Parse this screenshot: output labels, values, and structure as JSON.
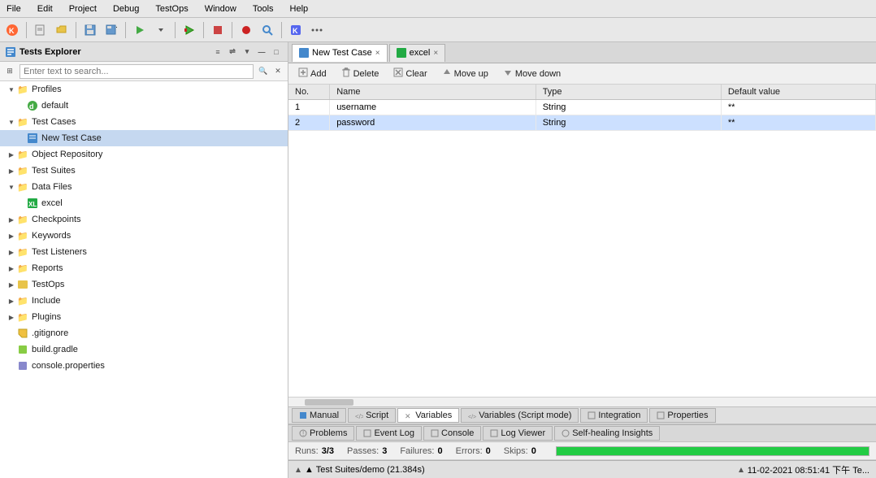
{
  "menu": {
    "items": [
      "File",
      "Edit",
      "Project",
      "Debug",
      "TestOps",
      "Window",
      "Tools",
      "Help"
    ]
  },
  "leftPanel": {
    "title": "Tests Explorer",
    "searchPlaceholder": "Enter text to search...",
    "tree": [
      {
        "id": "profiles",
        "label": "Profiles",
        "level": 0,
        "type": "folder",
        "expanded": true
      },
      {
        "id": "default",
        "label": "default",
        "level": 1,
        "type": "profile-file"
      },
      {
        "id": "testcases",
        "label": "Test Cases",
        "level": 0,
        "type": "folder",
        "expanded": true
      },
      {
        "id": "newtestcase",
        "label": "New Test Case",
        "level": 1,
        "type": "testcase",
        "selected": true
      },
      {
        "id": "objectrepo",
        "label": "Object Repository",
        "level": 0,
        "type": "folder",
        "expanded": false
      },
      {
        "id": "testsuites",
        "label": "Test Suites",
        "level": 0,
        "type": "folder",
        "expanded": false
      },
      {
        "id": "datafiles",
        "label": "Data Files",
        "level": 0,
        "type": "folder",
        "expanded": true
      },
      {
        "id": "excel",
        "label": "excel",
        "level": 1,
        "type": "data-file"
      },
      {
        "id": "checkpoints",
        "label": "Checkpoints",
        "level": 0,
        "type": "folder",
        "expanded": false
      },
      {
        "id": "keywords",
        "label": "Keywords",
        "level": 0,
        "type": "folder",
        "expanded": false
      },
      {
        "id": "testlisteners",
        "label": "Test Listeners",
        "level": 0,
        "type": "folder",
        "expanded": false
      },
      {
        "id": "reports",
        "label": "Reports",
        "level": 0,
        "type": "folder",
        "expanded": false
      },
      {
        "id": "testops",
        "label": "TestOps",
        "level": 0,
        "type": "folder",
        "expanded": false
      },
      {
        "id": "include",
        "label": "Include",
        "level": 0,
        "type": "folder",
        "expanded": false
      },
      {
        "id": "plugins",
        "label": "Plugins",
        "level": 0,
        "type": "folder",
        "expanded": false
      },
      {
        "id": "gitignore",
        "label": ".gitignore",
        "level": 0,
        "type": "file-git"
      },
      {
        "id": "buildgradle",
        "label": "build.gradle",
        "level": 0,
        "type": "file-gradle"
      },
      {
        "id": "consoleprops",
        "label": "console.properties",
        "level": 0,
        "type": "file-props"
      }
    ]
  },
  "tabs": [
    {
      "id": "newtestcase-tab",
      "label": "New Test Case",
      "active": true,
      "closable": true
    },
    {
      "id": "excel-tab",
      "label": "excel",
      "active": false,
      "closable": true
    }
  ],
  "contentToolbar": {
    "add": "Add",
    "delete": "Delete",
    "clear": "Clear",
    "moveup": "Move up",
    "movedown": "Move down"
  },
  "table": {
    "columns": [
      {
        "id": "no",
        "label": "No."
      },
      {
        "id": "name",
        "label": "Name"
      },
      {
        "id": "type",
        "label": "Type"
      },
      {
        "id": "default",
        "label": "Default value"
      }
    ],
    "rows": [
      {
        "no": "1",
        "name": "username",
        "type": "String",
        "default": "**",
        "selected": false
      },
      {
        "no": "2",
        "name": "password",
        "type": "String",
        "default": "**",
        "selected": true
      }
    ]
  },
  "bottomTabs": {
    "items": [
      "Manual",
      "Script",
      "Variables",
      "Variables (Script mode)",
      "Integration",
      "Properties"
    ]
  },
  "consoleTabs": {
    "items": [
      "Problems",
      "Event Log",
      "Console",
      "Log Viewer",
      "Self-healing Insights"
    ]
  },
  "statusBar": {
    "runs_label": "Runs:",
    "runs_value": "3/3",
    "passes_label": "Passes:",
    "passes_value": "3",
    "failures_label": "Failures:",
    "failures_value": "0",
    "errors_label": "Errors:",
    "errors_value": "0",
    "skips_label": "Skips:",
    "skips_value": "0",
    "progress": 100
  },
  "bottomStatus": {
    "left": "▲ Test Suites/demo (21.384s)",
    "right": "11-02-2021 08:51:41 下午 Te..."
  }
}
